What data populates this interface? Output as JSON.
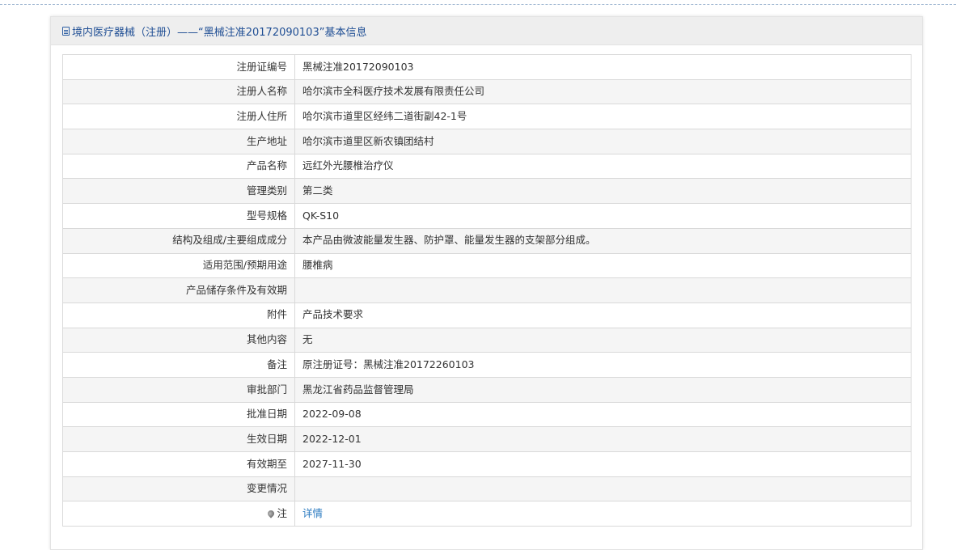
{
  "header": {
    "title": "境内医疗器械（注册）——“黑械注准20172090103”基本信息"
  },
  "rows": [
    {
      "label": "注册证编号",
      "value": "黑械注准20172090103"
    },
    {
      "label": "注册人名称",
      "value": "哈尔滨市全科医疗技术发展有限责任公司"
    },
    {
      "label": "注册人住所",
      "value": "哈尔滨市道里区经纬二道街副42-1号"
    },
    {
      "label": "生产地址",
      "value": "哈尔滨市道里区新农镇团结村"
    },
    {
      "label": "产品名称",
      "value": "远红外光腰椎治疗仪"
    },
    {
      "label": "管理类别",
      "value": "第二类"
    },
    {
      "label": "型号规格",
      "value": "QK-S10"
    },
    {
      "label": "结构及组成/主要组成成分",
      "value": "本产品由微波能量发生器、防护罩、能量发生器的支架部分组成。"
    },
    {
      "label": "适用范围/预期用途",
      "value": "腰椎病"
    },
    {
      "label": "产品储存条件及有效期",
      "value": ""
    },
    {
      "label": "附件",
      "value": "产品技术要求"
    },
    {
      "label": "其他内容",
      "value": "无"
    },
    {
      "label": "备注",
      "value": "原注册证号：黑械注准20172260103"
    },
    {
      "label": "审批部门",
      "value": "黑龙江省药品监督管理局"
    },
    {
      "label": "批准日期",
      "value": "2022-09-08"
    },
    {
      "label": "生效日期",
      "value": "2022-12-01"
    },
    {
      "label": "有效期至",
      "value": "2027-11-30"
    },
    {
      "label": "变更情况",
      "value": ""
    }
  ],
  "note_row": {
    "label": "注",
    "link_text": "详情"
  },
  "icons": {
    "header_icon": "document-icon",
    "note_icon": "map-pin-icon"
  },
  "colors": {
    "title": "#1f4e94",
    "link": "#2a7ac0",
    "header_bg": "#eeeeee"
  }
}
